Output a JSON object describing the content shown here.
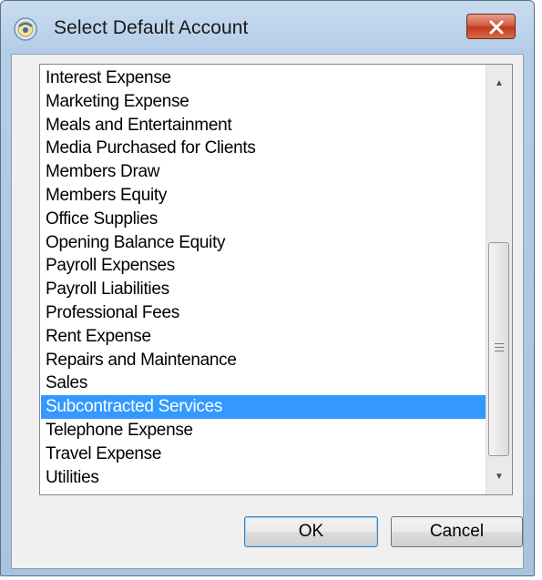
{
  "window": {
    "title": "Select Default Account",
    "close_icon": "close-icon",
    "app_icon": "app-icon"
  },
  "accounts": {
    "items": [
      "Interest Expense",
      "Marketing Expense",
      "Meals and Entertainment",
      "Media Purchased for Clients",
      "Members Draw",
      "Members Equity",
      "Office Supplies",
      "Opening Balance Equity",
      "Payroll Expenses",
      "Payroll Liabilities",
      "Professional Fees",
      "Rent Expense",
      "Repairs and Maintenance",
      "Sales",
      "Subcontracted Services",
      "Telephone Expense",
      "Travel Expense",
      "Utilities"
    ],
    "selected": "Subcontracted Services",
    "scroll_position": 1.0
  },
  "buttons": {
    "ok": "OK",
    "cancel": "Cancel"
  },
  "colors": {
    "selection": "#3399ff",
    "close_button": "#c8452a"
  }
}
